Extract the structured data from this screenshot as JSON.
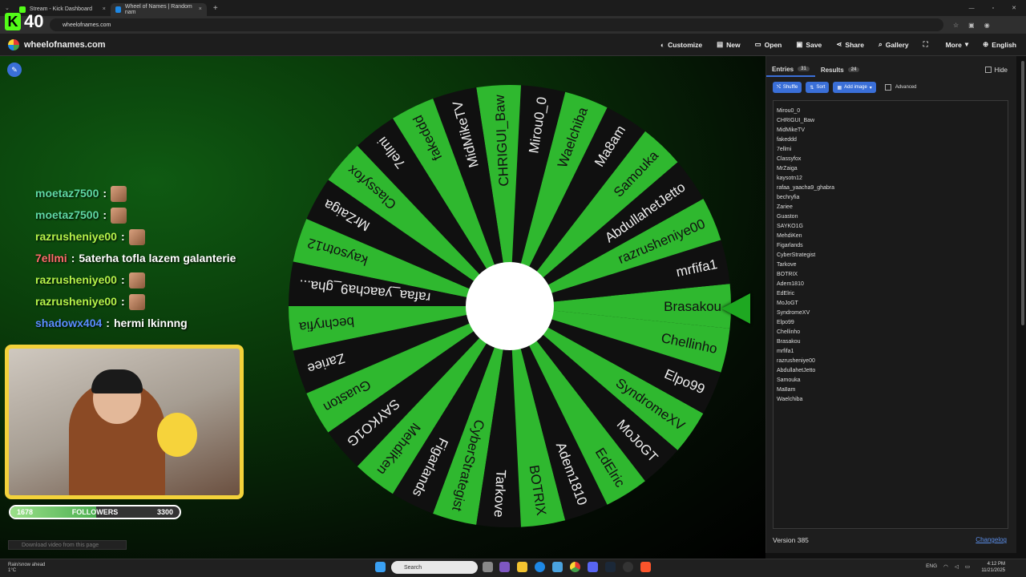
{
  "browser": {
    "tabs": [
      {
        "title": "Stream - Kick Dashboard",
        "active": false,
        "fav_color": "#53fc18"
      },
      {
        "title": "Wheel of Names | Random nam",
        "active": true,
        "fav_color": "#1e88e5"
      }
    ],
    "url": "wheelofnames.com"
  },
  "overlay": {
    "kick_logo": "K",
    "viewer_count": "40"
  },
  "site": {
    "name": "wheelofnames.com",
    "nav": [
      {
        "label": "Customize",
        "icon": "palette-icon",
        "glyph": "◐"
      },
      {
        "label": "New",
        "icon": "file-icon",
        "glyph": "▤"
      },
      {
        "label": "Open",
        "icon": "folder-icon",
        "glyph": "▭"
      },
      {
        "label": "Save",
        "icon": "save-icon",
        "glyph": "▣"
      },
      {
        "label": "Share",
        "icon": "share-icon",
        "glyph": "⋖"
      },
      {
        "label": "Gallery",
        "icon": "search-icon",
        "glyph": "⌕"
      },
      {
        "label": "",
        "icon": "fullscreen-icon",
        "glyph": "⛶"
      },
      {
        "label": "More",
        "icon": "chevron-down-icon",
        "glyph": "▾"
      },
      {
        "label": "English",
        "icon": "globe-icon",
        "glyph": "⊕"
      }
    ]
  },
  "chat": [
    {
      "user": "moetaz7500",
      "color": "#5fd7a4",
      "text": "",
      "emote": true
    },
    {
      "user": "moetaz7500",
      "color": "#5fd7a4",
      "text": "",
      "emote": true
    },
    {
      "user": "razrusheniye00",
      "color": "#b6f34a",
      "text": "",
      "emote": true
    },
    {
      "user": "7ellmi",
      "color": "#ff6b6b",
      "text": "5aterha tofla lazem galanterie",
      "emote": false
    },
    {
      "user": "razrusheniye00",
      "color": "#b6f34a",
      "text": "",
      "emote": true
    },
    {
      "user": "razrusheniye00",
      "color": "#b6f34a",
      "text": "",
      "emote": true
    },
    {
      "user": "shadowx404",
      "color": "#5a8dff",
      "text": "hermi lkinnng",
      "emote": false
    }
  ],
  "followers": {
    "current": "1678",
    "label": "FOLLOWERS",
    "goal": "3300",
    "progress": 0.508
  },
  "download_text": "Download video from this page",
  "wheel": {
    "colors": {
      "green": "#2fb82f",
      "black": "#101010",
      "pointer": "#1ea821"
    },
    "segments": [
      "Brasakou",
      "mrfifa1",
      "razrusheniye00",
      "AbdullahetJetto",
      "Samouka",
      "Ma8am",
      "Waelchiba",
      "Mirou0_0",
      "CHRIGUI_Baw",
      "MidMikeTV",
      "fakeddd",
      "7ellmi",
      "Classyfox",
      "MrZaiga",
      "kaysotn12",
      "rafaa_yaacha9_gha...",
      "bechryfia",
      "Zariee",
      "Guaston",
      "SAYKO1G",
      "MehdiKen",
      "Figarlands",
      "CyberStrategist",
      "Tarkove",
      "BOTRIX",
      "Adem1810",
      "EdElric",
      "MoJoGT",
      "SyndromeXV",
      "Elpo99",
      "Chellinho"
    ]
  },
  "panel": {
    "entries_label": "Entries",
    "entries_count": "31",
    "results_label": "Results",
    "results_count": "24",
    "hide_label": "Hide",
    "shuffle_label": "Shuffle",
    "sort_label": "Sort",
    "add_image_label": "Add image",
    "advanced_label": "Advanced",
    "entries": [
      "Mirou0_0",
      "CHRIGUI_Baw",
      "MidMikeTV",
      "fakeddd",
      "7ellmi",
      "Classyfox",
      "MrZaiga",
      "kaysotn12",
      "rafaa_yaacha9_ghabra",
      "bechryfia",
      "Zariee",
      "Guaston",
      "SAYKO1G",
      "MehdiKen",
      "Figarlands",
      "CyberStrategist",
      "Tarkove",
      "BOTRIX",
      "Adem1810",
      "EdElric",
      "MoJoGT",
      "SyndromeXV",
      "Elpo99",
      "Chellinho",
      "Brasakou",
      "mrfifa1",
      "razrusheniye00",
      "AbdullahetJetto",
      "Samouka",
      "Ma8am",
      "Waelchiba"
    ],
    "version": "Version 385",
    "changelog": "Changelog"
  },
  "taskbar": {
    "weather": "Rain/snow ahead",
    "temp": "1°C",
    "search_placeholder": "Search",
    "lang": "ENG",
    "time": "4:12 PM",
    "date": "11/21/2025"
  }
}
